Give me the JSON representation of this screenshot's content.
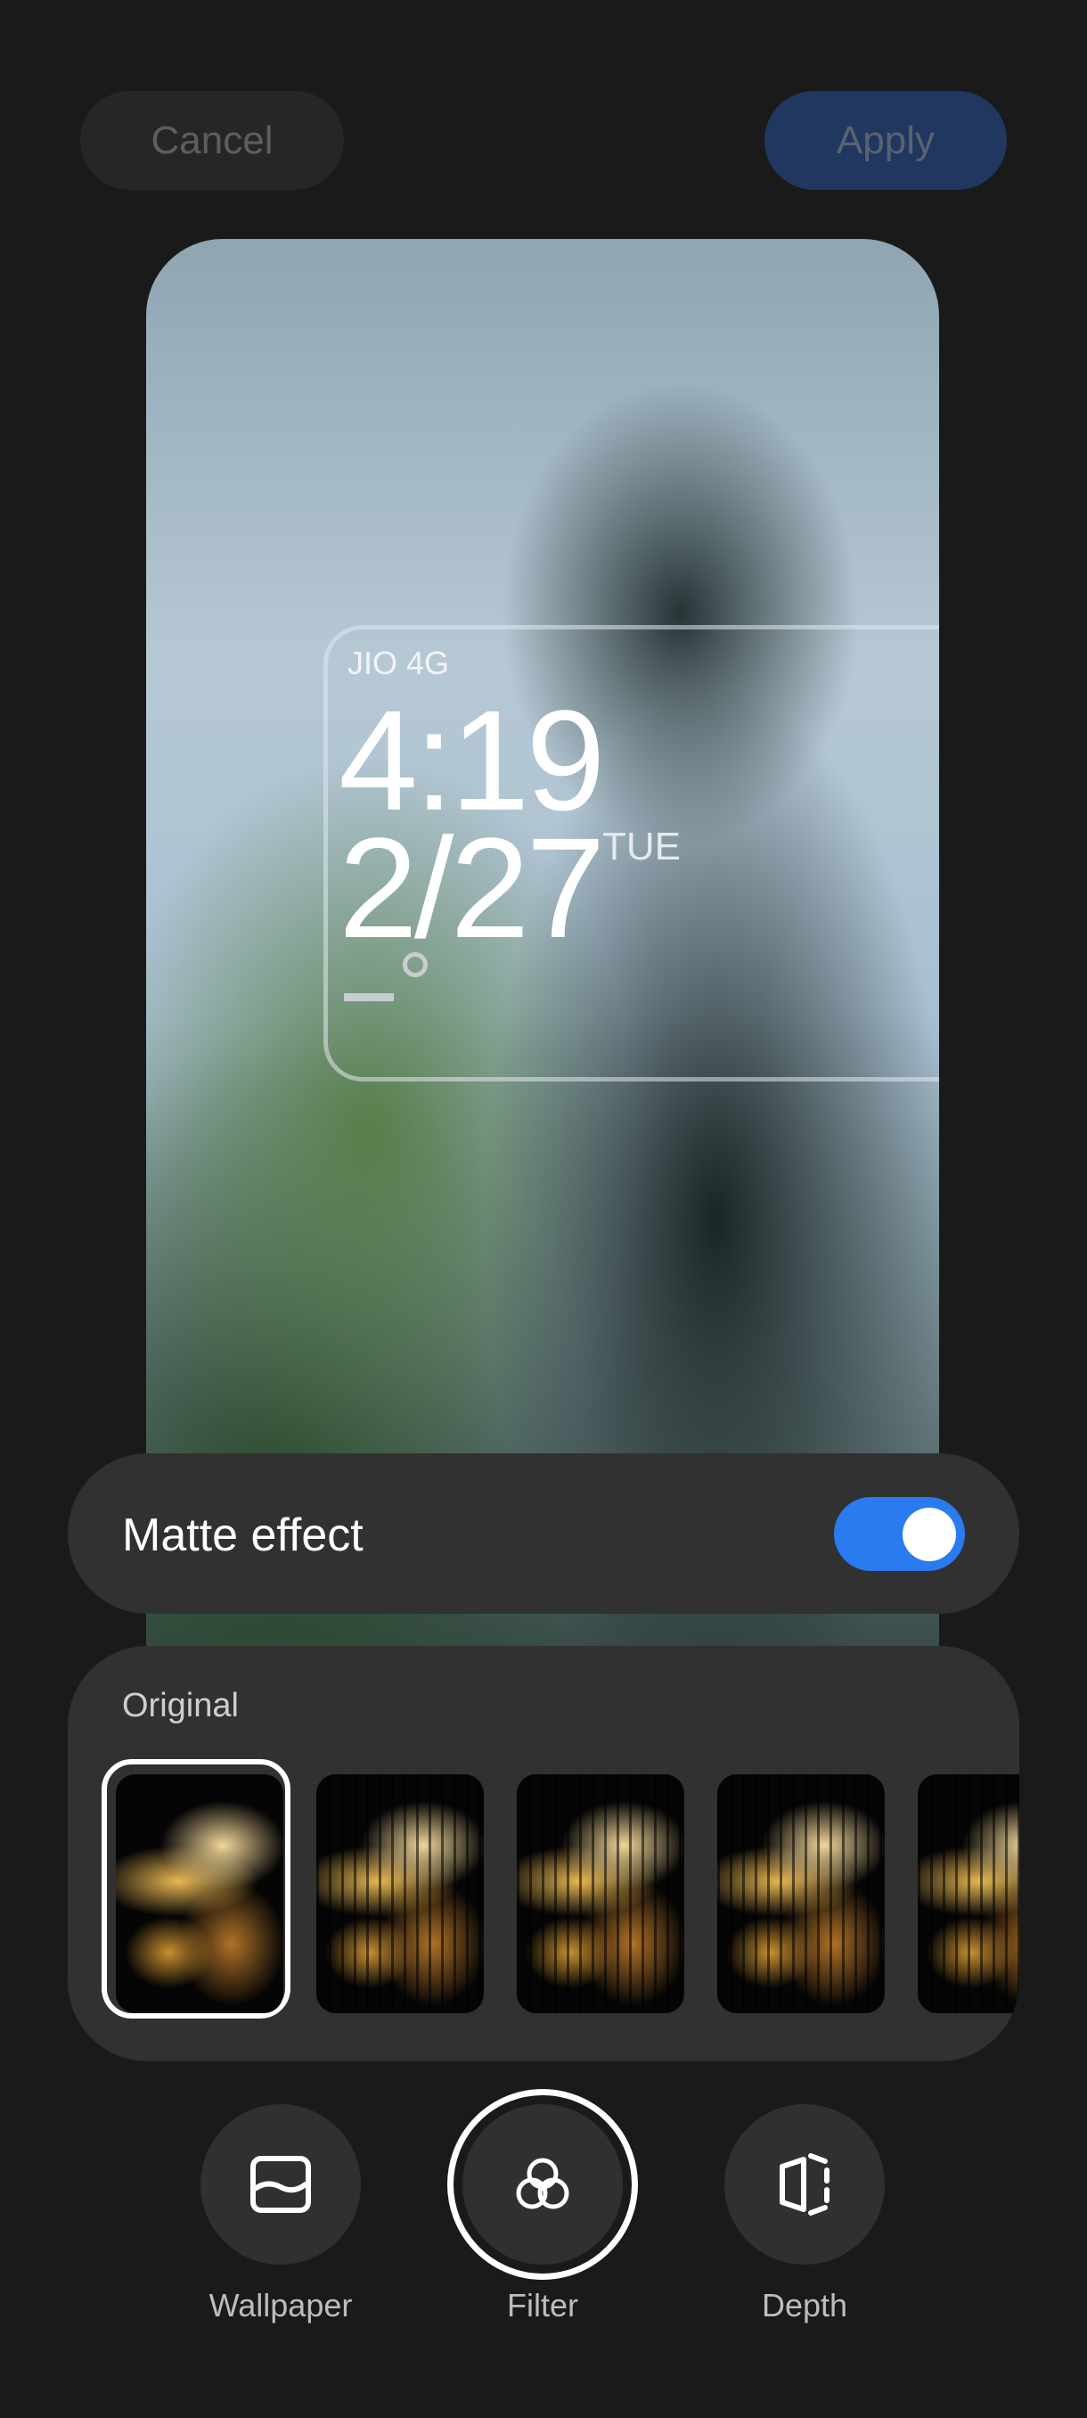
{
  "header": {
    "cancel_label": "Cancel",
    "apply_label": "Apply"
  },
  "lockscreen": {
    "carrier": "JIO 4G",
    "time": "4:19",
    "date": "2/27",
    "day": "TUE"
  },
  "matte_effect": {
    "label": "Matte effect",
    "enabled": true,
    "toggle_color": "#2a7af0"
  },
  "filters": {
    "selected_label": "Original",
    "thumbnails": [
      {
        "name": "Original",
        "selected": true
      },
      {
        "selected": false
      },
      {
        "selected": false
      },
      {
        "selected": false
      },
      {
        "selected": false
      }
    ]
  },
  "bottom_nav": {
    "items": [
      {
        "label": "Wallpaper",
        "icon": "wallpaper-icon"
      },
      {
        "label": "Filter",
        "icon": "filter-icon",
        "selected": true
      },
      {
        "label": "Depth",
        "icon": "depth-icon"
      }
    ]
  }
}
